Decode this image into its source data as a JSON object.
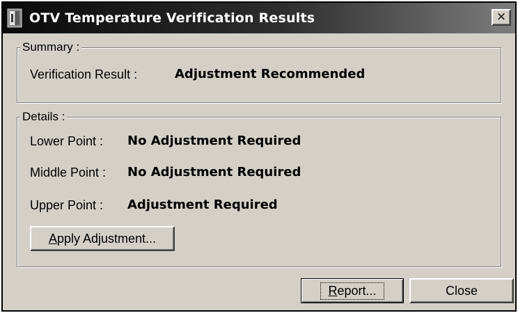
{
  "window": {
    "title": "OTV Temperature Verification Results",
    "close_glyph": "×",
    "title_gradient_start": "#0a0a0a",
    "title_gradient_end": "#7d7d7d",
    "face_color": "#d4d0c8"
  },
  "summary": {
    "group_label": "Summary :",
    "result_label": "Verification Result :",
    "result_value": "Adjustment Recommended"
  },
  "details": {
    "group_label": "Details :",
    "points": [
      {
        "label": "Lower Point :",
        "value": "No Adjustment Required"
      },
      {
        "label": "Middle Point :",
        "value": "No Adjustment Required"
      },
      {
        "label": "Upper Point :",
        "value": "Adjustment Required"
      }
    ],
    "apply_button": {
      "mnemonic": "A",
      "rest": "pply Adjustment..."
    }
  },
  "buttons": {
    "report": {
      "mnemonic": "R",
      "rest": "eport..."
    },
    "close": {
      "label": "Close"
    }
  }
}
